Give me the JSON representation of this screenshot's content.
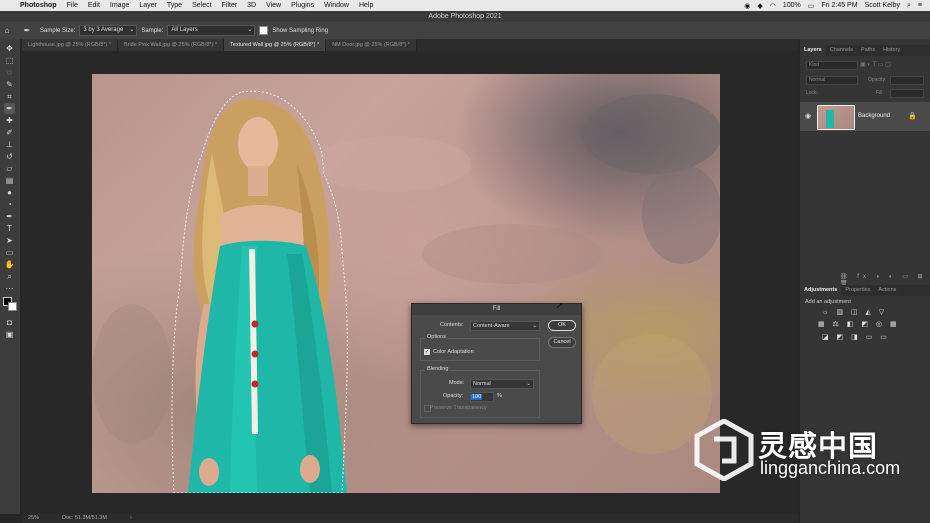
{
  "menubar": {
    "app": "Photoshop",
    "items": [
      "File",
      "Edit",
      "Image",
      "Layer",
      "Type",
      "Select",
      "Filter",
      "3D",
      "View",
      "Plugins",
      "Window",
      "Help"
    ],
    "battery": "100%",
    "time": "Fri 2:45 PM",
    "user": "Scott Kelby"
  },
  "window": {
    "title": "Adobe Photoshop 2021"
  },
  "options": {
    "sample_size_label": "Sample Size:",
    "sample_size_value": "3 by 3 Average",
    "sample_label": "Sample:",
    "sample_value": "All Layers",
    "show_ring_label": "Show Sampling Ring"
  },
  "tabs": [
    {
      "label": "Lighthouse.jpg @ 25% (RGB/8*) *"
    },
    {
      "label": "Bride Pink Wall.jpg @ 25% (RGB/8*) *"
    },
    {
      "label": "Textured Wall.jpg @ 25% (RGB/8*) *"
    },
    {
      "label": "NM Door.jpg @ 25% (RGB/8*) *"
    }
  ],
  "status": {
    "zoom": "25%",
    "doc": "Doc: 51.3M/51.3M"
  },
  "layers_panel": {
    "tabs": [
      "Layers",
      "Channels",
      "Paths",
      "History"
    ],
    "kind": "Kind",
    "mode": "Normal",
    "opacity_label": "Opacity:",
    "fill_label": "Fill:",
    "lock_label": "Lock:",
    "layer_name": "Background"
  },
  "adjustments_panel": {
    "tabs": [
      "Adjustments",
      "Properties",
      "Actions"
    ],
    "add_label": "Add an adjustment"
  },
  "fill_dialog": {
    "title": "Fill",
    "contents_label": "Contents:",
    "contents_value": "Content-Aware",
    "ok": "OK",
    "cancel": "Cancel",
    "options_label": "Options",
    "color_adaptation": "Color Adaptation",
    "blending_label": "Blending",
    "mode_label": "Mode:",
    "mode_value": "Normal",
    "opacity_label": "Opacity:",
    "opacity_value": "100",
    "opacity_unit": "%",
    "preserve_transparency": "Preserve Transparency"
  },
  "watermark": {
    "cn": "灵感中国",
    "en": "lingganchina.com"
  },
  "colors": {
    "accent": "#1e9bd7",
    "dress": "#1fb8a8",
    "wall": "#c29d95"
  }
}
